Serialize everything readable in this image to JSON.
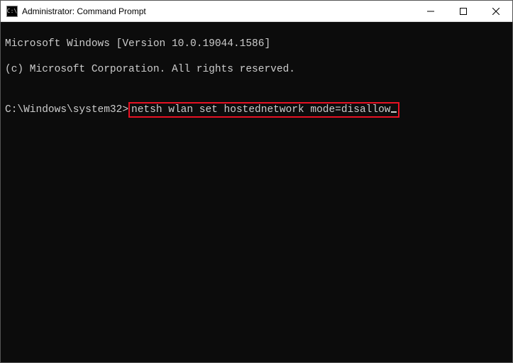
{
  "window": {
    "title": "Administrator: Command Prompt"
  },
  "terminal": {
    "line1": "Microsoft Windows [Version 10.0.19044.1586]",
    "line2": "(c) Microsoft Corporation. All rights reserved.",
    "blank": "",
    "prompt": "C:\\Windows\\system32>",
    "command": "netsh wlan set hostednetwork mode=disallow"
  },
  "icons": {
    "cmd": "C:\\",
    "minimize": "minimize",
    "maximize": "maximize",
    "close": "close"
  }
}
